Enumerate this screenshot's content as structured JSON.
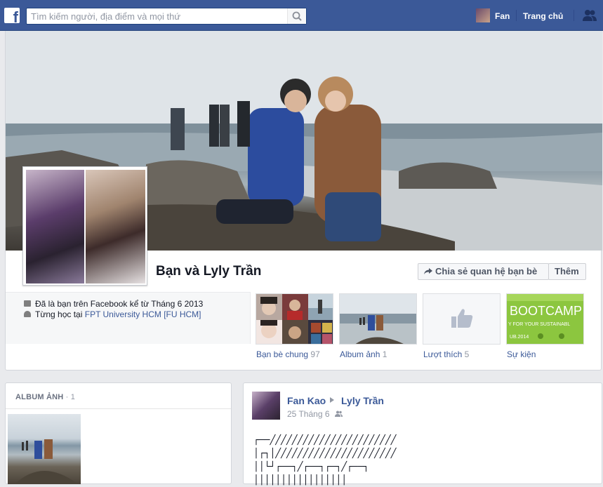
{
  "topbar": {
    "search_placeholder": "Tìm kiếm người, địa điểm và mọi thứ",
    "user_name": "Fan",
    "home_label": "Trang chủ"
  },
  "profile": {
    "heading": "Bạn và Lyly Trần",
    "share_button": "Chia sẻ quan hệ bạn bè",
    "more_button": "Thêm",
    "info": {
      "friends_since": "Đã là bạn trên Facebook kể từ Tháng 6 2013",
      "studied_prefix": "Từng học tại ",
      "school": "FPT University HCM [FU HCM]"
    },
    "tiles": [
      {
        "label": "Bạn bè chung",
        "count": "97"
      },
      {
        "label": "Album ảnh",
        "count": "1"
      },
      {
        "label": "Lượt thích",
        "count": "5"
      },
      {
        "label": "Sự kiện",
        "count": ""
      }
    ],
    "bootcamp_text": "BOOTCAMP",
    "bootcamp_sub": "Y FOR YOUR SUSTAINABL",
    "bootcamp_date": "UB.2014"
  },
  "album": {
    "title": "ALBUM ẢNH",
    "count": "· 1"
  },
  "post": {
    "author": "Fan Kao",
    "target": "Lyly Trần",
    "date": "25 Tháng 6",
    "ascii_art": "┌──╱╱╱╱╱╱╱╱╱╱╱╱╱╱╱╱╱╱╱╱╱╱╱\n│┌┐│╱╱╱╱╱╱╱╱╱╱╱╱╱╱╱╱╱╱╱╱╱╱\n││└┘┌──┐╱┌──┐┌─┐╱┌──┐\n│││││││││││││││││"
  },
  "colors": {
    "brand": "#3b5998",
    "link": "#3b5998",
    "muted": "#9197a3",
    "bootcamp_green": "#8cc63f"
  }
}
